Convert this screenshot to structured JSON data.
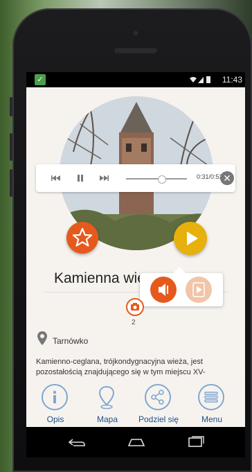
{
  "status_bar": {
    "time": "11:43"
  },
  "player": {
    "time": "0:31/0:53",
    "progress": 0.58
  },
  "place": {
    "title": "Kamienna wie",
    "photo_count": "2",
    "location": "Tarnówko",
    "description": "Kamienno-ceglana, trójkondygnacyjna wieża, jest pozostałością znajdującego się w tym miejscu XV-"
  },
  "nav": [
    {
      "label": "Opis",
      "icon": "info-icon"
    },
    {
      "label": "Mapa",
      "icon": "map-pin-icon"
    },
    {
      "label": "Podziel się",
      "icon": "share-icon"
    },
    {
      "label": "Menu",
      "icon": "menu-icon"
    }
  ],
  "colors": {
    "accent_orange": "#e55a1c",
    "accent_yellow": "#e6b10c",
    "nav_blue": "#1f4f86"
  }
}
